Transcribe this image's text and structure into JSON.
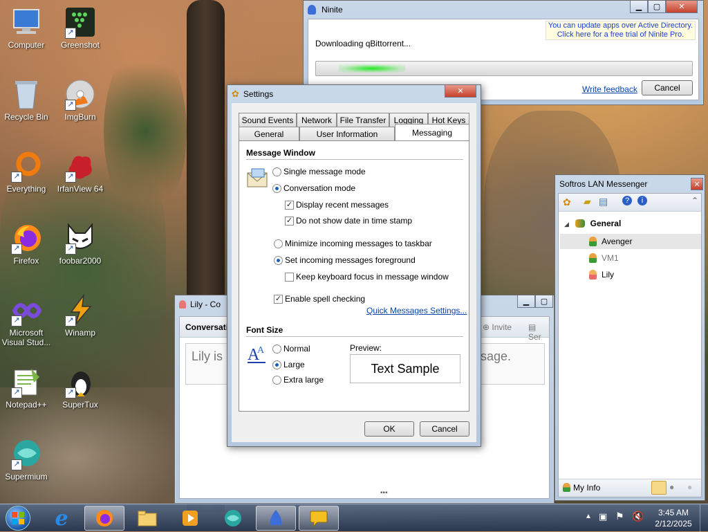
{
  "desktop": {
    "icons": [
      {
        "label": "Computer",
        "icon": "computer-icon"
      },
      {
        "label": "Greenshot",
        "icon": "greenshot-icon"
      },
      {
        "label": "Recycle Bin",
        "icon": "recycle-bin-icon"
      },
      {
        "label": "ImgBurn",
        "icon": "imgburn-icon"
      },
      {
        "label": "Everything",
        "icon": "everything-icon"
      },
      {
        "label": "IrfanView 64",
        "icon": "irfanview-icon"
      },
      {
        "label": "Firefox",
        "icon": "firefox-icon"
      },
      {
        "label": "foobar2000",
        "icon": "foobar2000-icon"
      },
      {
        "label": "Microsoft Visual Stud...",
        "icon": "visual-studio-icon"
      },
      {
        "label": "Winamp",
        "icon": "winamp-icon"
      },
      {
        "label": "Notepad++",
        "icon": "notepadpp-icon"
      },
      {
        "label": "SuperTux",
        "icon": "supertux-icon"
      },
      {
        "label": "Supermium",
        "icon": "supermium-icon"
      }
    ]
  },
  "ninite": {
    "title": "Ninite",
    "status": "Downloading qBittorrent...",
    "ad_line1": "You can update apps over Active Directory.",
    "ad_line2": "Click here for a free trial of Ninite Pro.",
    "feedback_link": "Write feedback",
    "cancel_label": "Cancel",
    "progress": 0.08
  },
  "settings": {
    "title": "Settings",
    "tabs_row1": [
      "Sound Events",
      "Network",
      "File Transfer",
      "Logging",
      "Hot Keys"
    ],
    "tabs_row2": [
      "General",
      "User Information",
      "Messaging"
    ],
    "active_tab": "Messaging",
    "message_window": {
      "header": "Message Window",
      "single_mode": "Single message mode",
      "conversation_mode": "Conversation mode",
      "display_recent": "Display recent messages",
      "no_date": "Do not show date in time stamp",
      "minimize_incoming": "Minimize incoming messages to taskbar",
      "set_foreground": "Set incoming messages foreground",
      "keep_focus": "Keep keyboard focus in message window",
      "spell_check": "Enable spell checking",
      "quick_link": "Quick Messages Settings..."
    },
    "font_size": {
      "header": "Font Size",
      "normal": "Normal",
      "large": "Large",
      "extra_large": "Extra large",
      "preview_label": "Preview:",
      "preview_text": "Text Sample"
    },
    "ok_label": "OK",
    "cancel_label": "Cancel"
  },
  "lily_window": {
    "title": "Lily - Co",
    "conversation_label": "Conversati",
    "message_start": "Lily is",
    "message_end": "sage.",
    "invite_label": "Invite",
    "send_label": "Ser"
  },
  "lan_messenger": {
    "title": "Softros LAN Messenger",
    "group": "General",
    "users": [
      "Avenger",
      "VM1",
      "Lily"
    ],
    "my_info": "My Info"
  },
  "taskbar": {
    "time": "3:45 AM",
    "date": "2/12/2025"
  },
  "colors": {
    "accent": "#1c5fb8",
    "progress_green": "#22c322",
    "link": "#0645ad"
  }
}
